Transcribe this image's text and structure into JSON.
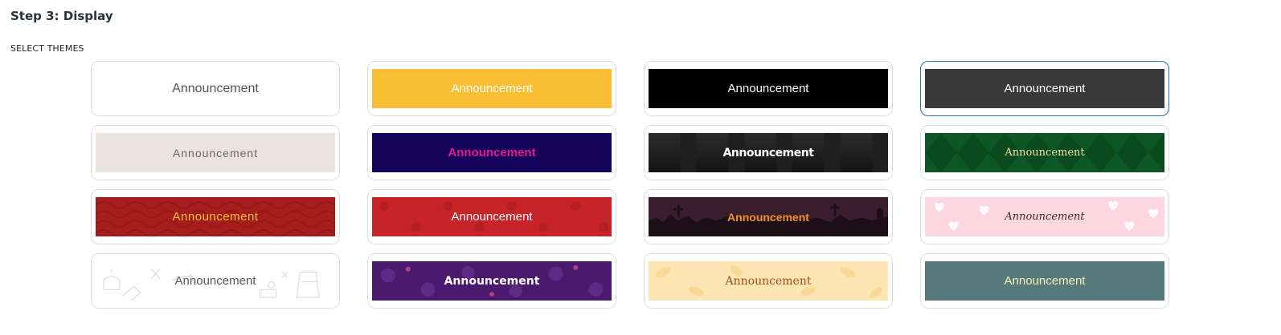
{
  "step_title": "Step 3: Display",
  "section_label": "SELECT THEMES",
  "selected_theme_index": 3,
  "themes": [
    {
      "id": "plain",
      "label": "Announcement",
      "background": "#ffffff",
      "text_color": "#50575e"
    },
    {
      "id": "yellow",
      "label": "Announcement",
      "background": "#fbbf35",
      "text_color": "#ffffff"
    },
    {
      "id": "black",
      "label": "Announcement",
      "background": "#000000",
      "text_color": "#ffffff"
    },
    {
      "id": "charcoal",
      "label": "Announcement",
      "background": "#393939",
      "text_color": "#ffffff"
    },
    {
      "id": "beige",
      "label": "Announcement",
      "background": "#e9e4dd",
      "text_color": "#6b6560"
    },
    {
      "id": "navy",
      "label": "Announcement",
      "background": "#14045c",
      "text_color": "#e6168e"
    },
    {
      "id": "dark-pattern",
      "label": "Announcement",
      "background": "#1f1f1f",
      "text_color": "#ffffff"
    },
    {
      "id": "green-diamonds",
      "label": "Announcement",
      "background": "#0d5625",
      "text_color": "#f2e6a3"
    },
    {
      "id": "red-waves",
      "label": "Announcement",
      "background": "#a61d1d",
      "text_color": "#fbbf35"
    },
    {
      "id": "red-flowers",
      "label": "Announcement",
      "background": "#c62428",
      "text_color": "#ffffff"
    },
    {
      "id": "halloween",
      "label": "Announcement",
      "background": "#3b1d2d",
      "text_color": "#f0922a"
    },
    {
      "id": "pink-hearts",
      "label": "Announcement",
      "background": "#fcd6e0",
      "text_color": "#3a2a30"
    },
    {
      "id": "school-sketch",
      "label": "Announcement",
      "background": "#ffffff",
      "text_color": "#50575e"
    },
    {
      "id": "purple-skulls",
      "label": "Announcement",
      "background": "#4b1a6e",
      "text_color": "#ffffff"
    },
    {
      "id": "autumn-leaves",
      "label": "Announcement",
      "background": "#fde6b3",
      "text_color": "#9a4e16"
    },
    {
      "id": "teal",
      "label": "Announcement",
      "background": "#567a7c",
      "text_color": "#f6f0b6"
    }
  ]
}
